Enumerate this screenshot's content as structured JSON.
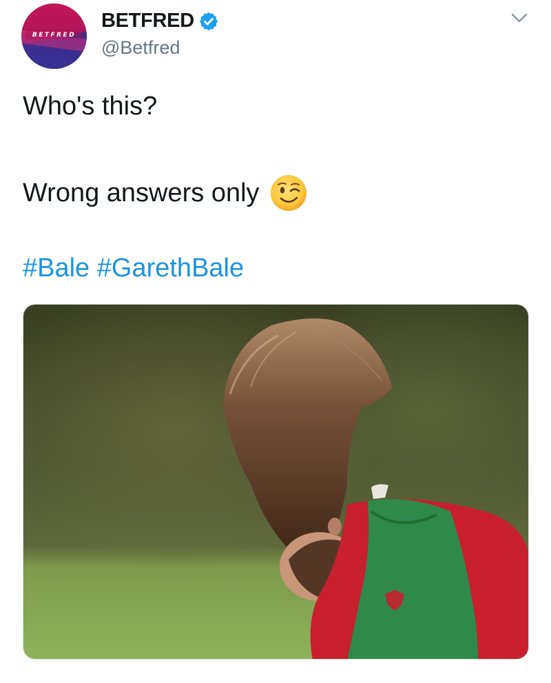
{
  "account": {
    "display_name": "BETFRED",
    "handle": "@Betfred",
    "avatar_text": "BETFRED",
    "verified": true
  },
  "tweet": {
    "line1": "Who's this?",
    "line2": "Wrong answers only",
    "hashtags": [
      "#Bale",
      "#GarethBale"
    ],
    "emoji": "winking-face"
  },
  "media": {
    "type": "photo"
  },
  "colors": {
    "link": "#1b95e0",
    "verified": "#1da1f2",
    "secondary_text": "#657786",
    "primary_text": "#14171a"
  },
  "icons": [
    "verified-badge-icon",
    "chevron-down-icon",
    "winking-face-emoji"
  ]
}
